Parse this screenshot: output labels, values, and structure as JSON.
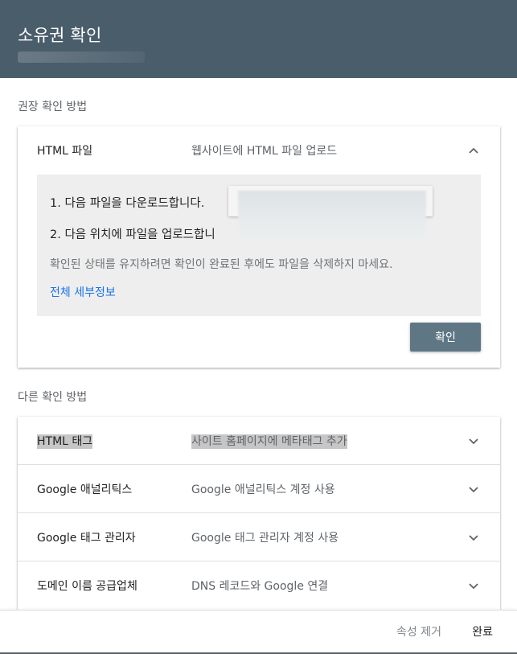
{
  "header": {
    "title": "소유권 확인"
  },
  "recommended": {
    "section_label": "권장 확인 방법",
    "method_name": "HTML 파일",
    "method_desc": "웹사이트에 HTML 파일 업로드",
    "steps": {
      "step1": "1. 다음 파일을 다운로드합니다.",
      "step2": "2. 다음 위치에 파일을 업로드합니",
      "note": "확인된 상태를 유지하려면 확인이 완료된 후에도 파일을 삭제하지 마세요.",
      "details_link": "전체 세부정보"
    },
    "verify_label": "확인"
  },
  "other": {
    "section_label": "다른 확인 방법",
    "methods": [
      {
        "name": "HTML 태그",
        "desc": "사이트 홈페이지에 메타태그 추가"
      },
      {
        "name": "Google 애널리틱스",
        "desc": "Google 애널리틱스 계정 사용"
      },
      {
        "name": "Google 태그 관리자",
        "desc": "Google 태그 관리자 계정 사용"
      },
      {
        "name": "도메인 이름 공급업체",
        "desc": "DNS 레코드와 Google 연결"
      }
    ]
  },
  "footer": {
    "remove_label": "속성 제거",
    "done_label": "완료"
  },
  "colors": {
    "header_bg": "#4a5d6b",
    "button_bg": "#5f7785",
    "link": "#1a73e8"
  },
  "icons": {
    "expand": "chevron-up-icon",
    "collapse": "chevron-down-icon"
  }
}
